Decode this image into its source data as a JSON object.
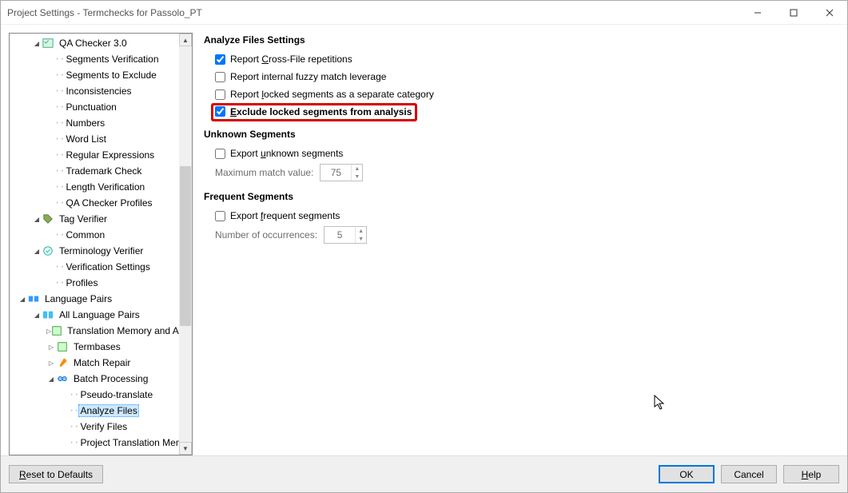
{
  "window": {
    "title": "Project Settings - Termchecks for Passolo_PT"
  },
  "tree": {
    "qa_checker": "QA Checker 3.0",
    "segments_verification": "Segments Verification",
    "segments_to_exclude": "Segments to Exclude",
    "inconsistencies": "Inconsistencies",
    "punctuation": "Punctuation",
    "numbers": "Numbers",
    "word_list": "Word List",
    "regular_expressions": "Regular Expressions",
    "trademark_check": "Trademark Check",
    "length_verification": "Length Verification",
    "qa_checker_profiles": "QA Checker Profiles",
    "tag_verifier": "Tag Verifier",
    "common": "Common",
    "terminology_verifier": "Terminology Verifier",
    "verification_settings": "Verification Settings",
    "profiles": "Profiles",
    "language_pairs": "Language Pairs",
    "all_language_pairs": "All Language Pairs",
    "translation_memory": "Translation Memory and A",
    "termbases": "Termbases",
    "match_repair": "Match Repair",
    "batch_processing": "Batch Processing",
    "pseudo_translate": "Pseudo-translate",
    "analyze_files": "Analyze Files",
    "verify_files": "Verify Files",
    "project_translation": "Project Translation Memori"
  },
  "sections": {
    "analyze_files_settings": "Analyze Files Settings",
    "unknown_segments": "Unknown Segments",
    "frequent_segments": "Frequent Segments"
  },
  "checkboxes": {
    "report_cross_file_pre": "Report ",
    "report_cross_file_u": "C",
    "report_cross_file_post": "ross-File repetitions",
    "report_cross_file_checked": true,
    "report_internal_fuzzy": "Report internal fuzzy match leverage",
    "report_internal_fuzzy_checked": false,
    "report_locked_pre": "Report ",
    "report_locked_u": "l",
    "report_locked_post": "ocked segments as a separate category",
    "report_locked_checked": false,
    "exclude_locked_u": "E",
    "exclude_locked_post": "xclude locked segments from analysis",
    "exclude_locked_checked": true,
    "export_unknown_pre": "Export ",
    "export_unknown_u": "u",
    "export_unknown_post": "nknown segments",
    "export_unknown_checked": false,
    "export_frequent_pre": "Export ",
    "export_frequent_u": "f",
    "export_frequent_post": "requent segments",
    "export_frequent_checked": false
  },
  "fields": {
    "max_match_label": "Maximum match value:",
    "max_match_value": "75",
    "num_occurrences_label": "Number of occurrences:",
    "num_occurrences_value": "5"
  },
  "buttons": {
    "reset_u": "R",
    "reset_post": "eset to Defaults",
    "ok": "OK",
    "cancel": "Cancel",
    "help_u": "H",
    "help_post": "elp"
  }
}
